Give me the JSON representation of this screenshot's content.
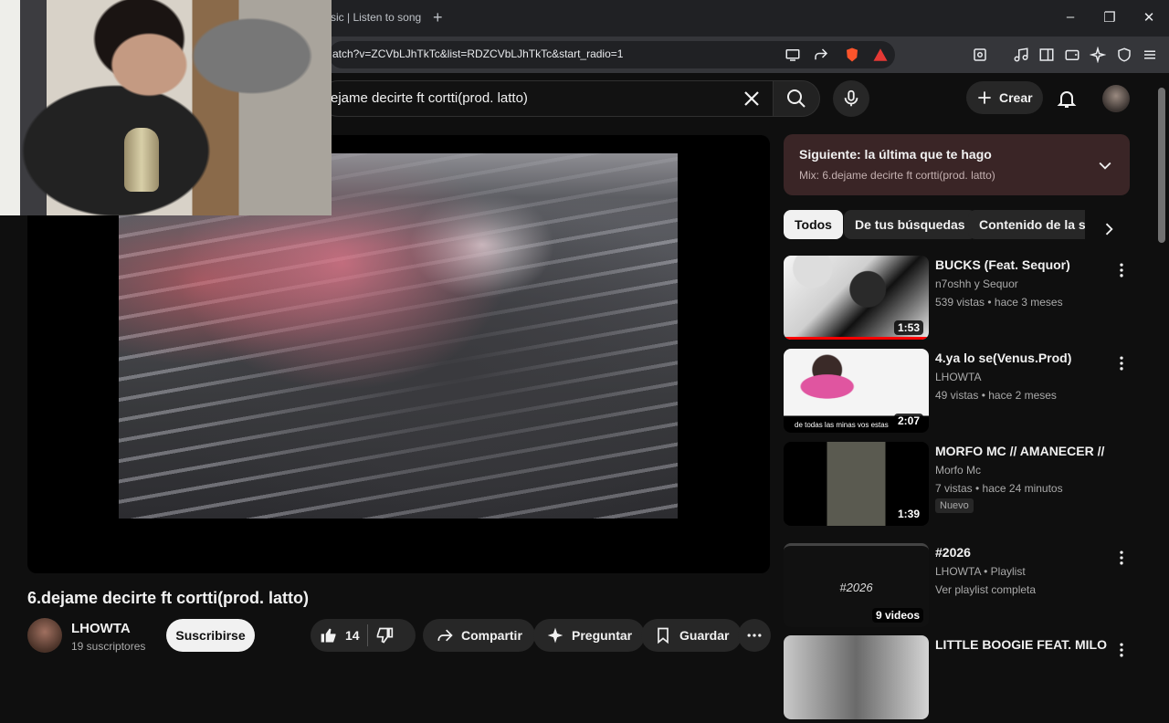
{
  "browser": {
    "tab_title": "sic | Listen to song",
    "new_tab": "+",
    "url": "atch?v=ZCVbLJhTkTc&list=RDZCVbLJhTkTc&start_radio=1",
    "window": {
      "minimize": "–",
      "restore": "❐",
      "close": "✕"
    }
  },
  "header": {
    "search_query": "ejame decirte ft cortti(prod. latto)",
    "create_label": "Crear"
  },
  "video": {
    "title": "6.dejame decirte ft cortti(prod. latto)",
    "channel": "LHOWTA",
    "subscribers": "19 suscriptores",
    "subscribe_label": "Suscribirse",
    "likes": "14",
    "share_label": "Compartir",
    "ask_label": "Preguntar",
    "save_label": "Guardar"
  },
  "up_next": {
    "title": "Siguiente: la última que te hago",
    "subtitle": "Mix: 6.dejame decirte ft cortti(prod. latto)"
  },
  "chips": [
    "Todos",
    "De tus búsquedas",
    "Contenido de la ser"
  ],
  "recommendations": [
    {
      "title": "BUCKS (Feat. Sequor)",
      "channel": "n7oshh y Sequor",
      "meta": "539 vistas • hace 3 meses",
      "duration": "1:53",
      "progress": 1.0
    },
    {
      "title": "4.ya lo se(Venus.Prod)",
      "channel": "LHOWTA",
      "meta": "49 vistas • hace 2 meses",
      "duration": "2:07",
      "thumb_caption": "de todas las minas vos estas"
    },
    {
      "title": "MORFO MC // AMANECER //",
      "channel": "Morfo Mc",
      "meta": "7 vistas • hace 24 minutos",
      "duration": "1:39",
      "badge": "Nuevo"
    },
    {
      "title": "#2026",
      "channel": "LHOWTA • Playlist",
      "meta": "Ver playlist completa",
      "duration": "9 videos",
      "thumb_text": "#2026"
    },
    {
      "title": "LITTLE BOOGIE FEAT. MILO J -",
      "channel": "",
      "meta": "",
      "duration": ""
    }
  ]
}
